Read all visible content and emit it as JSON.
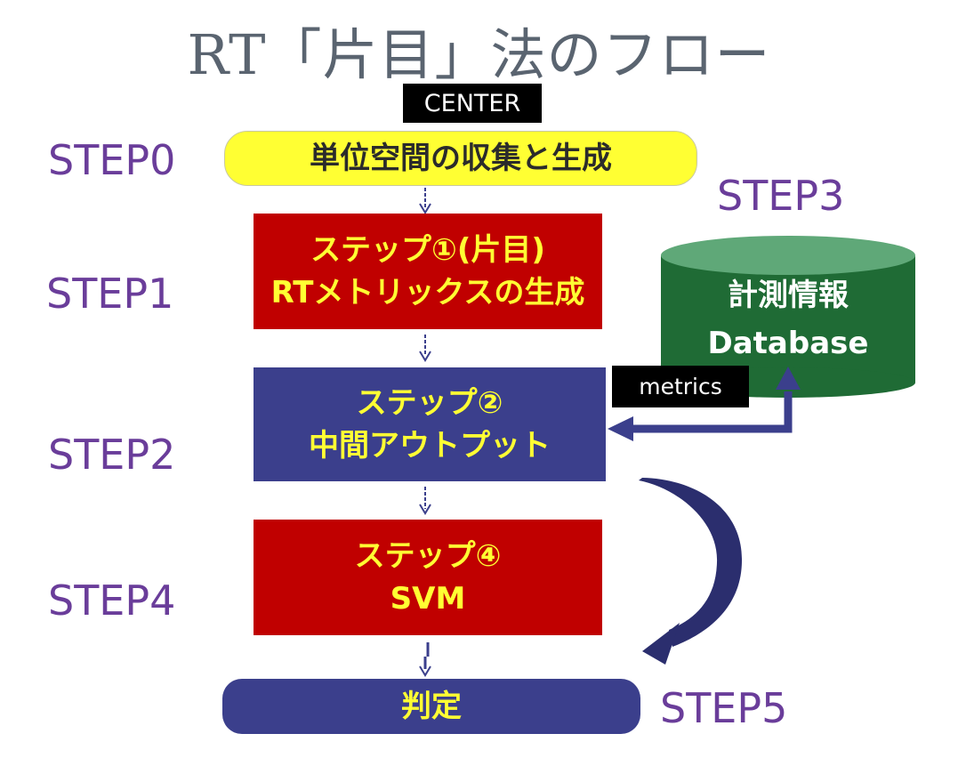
{
  "title": "RT「片目」法のフロー",
  "center_tag": "CENTER",
  "metrics_tag": "metrics",
  "steps": {
    "s0": "STEP0",
    "s1": "STEP1",
    "s2": "STEP2",
    "s3": "STEP3",
    "s4": "STEP4",
    "s5": "STEP5"
  },
  "boxes": {
    "collect": "単位空間の収集と生成",
    "step1_line1": "ステップ①(片目)",
    "step1_line2": "RTメトリックスの生成",
    "step2_line1": "ステップ②",
    "step2_line2": "中間アウトプット",
    "step4_line1": "ステップ④",
    "step4_line2": "SVM",
    "judge": "判定"
  },
  "database": {
    "line1": "計測情報",
    "line2": "Database"
  },
  "colors": {
    "step_label": "#6a3d9a",
    "yellow_box": "#ffff33",
    "red_box": "#c00000",
    "navy_box": "#3b3f8c",
    "db_green": "#1f6b35",
    "text_yellow": "#ffff33"
  }
}
